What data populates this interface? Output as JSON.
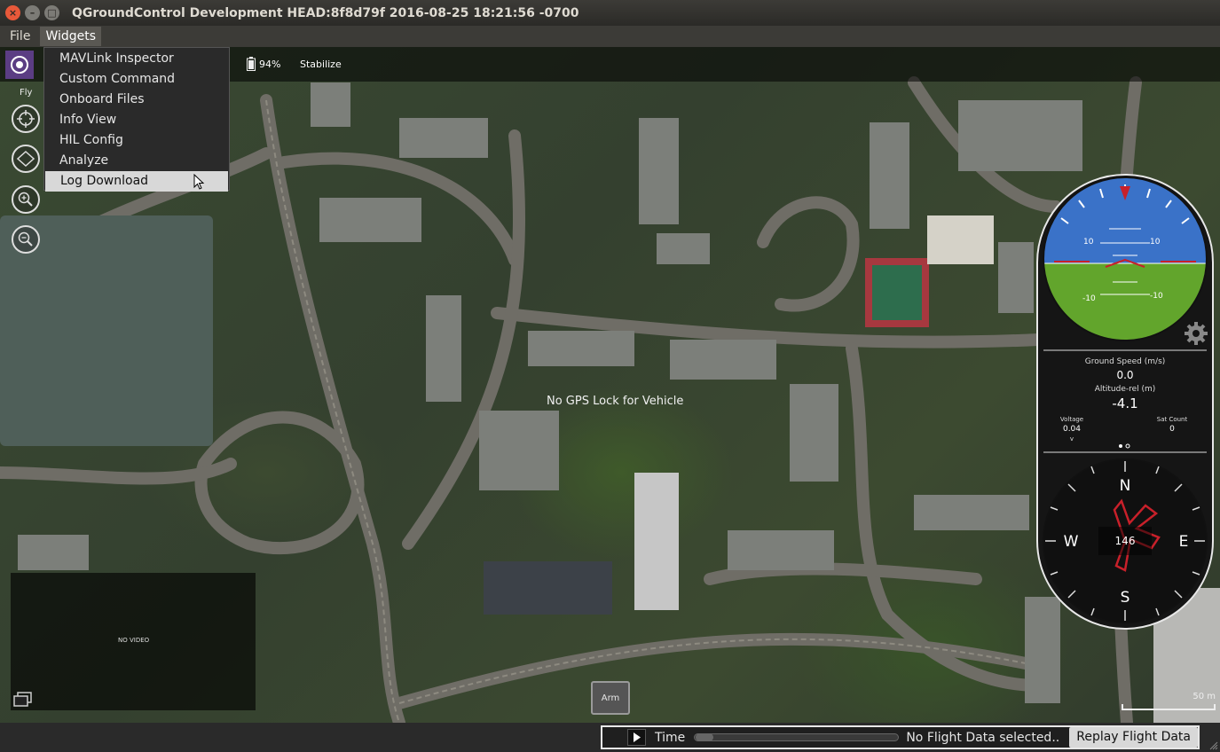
{
  "window": {
    "title": "QGroundControl Development HEAD:8f8d79f 2016-08-25 18:21:56 -0700"
  },
  "menubar": {
    "items": [
      {
        "label": "File"
      },
      {
        "label": "Widgets"
      }
    ]
  },
  "widgets_menu": {
    "items": [
      {
        "label": "MAVLink Inspector"
      },
      {
        "label": "Custom Command"
      },
      {
        "label": "Onboard Files"
      },
      {
        "label": "Info View"
      },
      {
        "label": "HIL Config"
      },
      {
        "label": "Analyze"
      },
      {
        "label": "Log Download"
      }
    ],
    "hovered": "Log Download"
  },
  "toolbar": {
    "battery": "94%",
    "flight_mode": "Stabilize"
  },
  "left_tools": {
    "fly_label": "Fly",
    "icons": [
      "center-map-icon",
      "map-type-icon",
      "zoom-in-icon",
      "zoom-out-icon"
    ]
  },
  "map": {
    "status_text": "No GPS Lock for Vehicle",
    "scale_label": "50 m"
  },
  "video": {
    "label": "NO VIDEO"
  },
  "arm": {
    "label": "Arm"
  },
  "instrument": {
    "attitude_ticks": {
      "pitch_up_left": "10",
      "pitch_up_right": "10",
      "pitch_down_left": "-10",
      "pitch_down_right": "-10"
    },
    "ground_speed_label": "Ground Speed (m/s)",
    "ground_speed_value": "0.0",
    "altitude_label": "Altitude-rel (m)",
    "altitude_value": "-4.1",
    "voltage_label": "Voltage",
    "voltage_value": "0.04",
    "voltage_unit": "v",
    "sat_label": "Sat Count",
    "sat_value": "0",
    "compass": {
      "n": "N",
      "e": "E",
      "s": "S",
      "w": "W",
      "heading": "146"
    }
  },
  "replay": {
    "time_label": "Time",
    "status": "No Flight Data selected..",
    "button": "Replay Flight Data"
  },
  "colors": {
    "sky": "#3a72c8",
    "ground": "#62a52c",
    "horizon_marker": "#c8202a",
    "compass_plane": "#c8202a",
    "logo": "#5b3d83"
  }
}
